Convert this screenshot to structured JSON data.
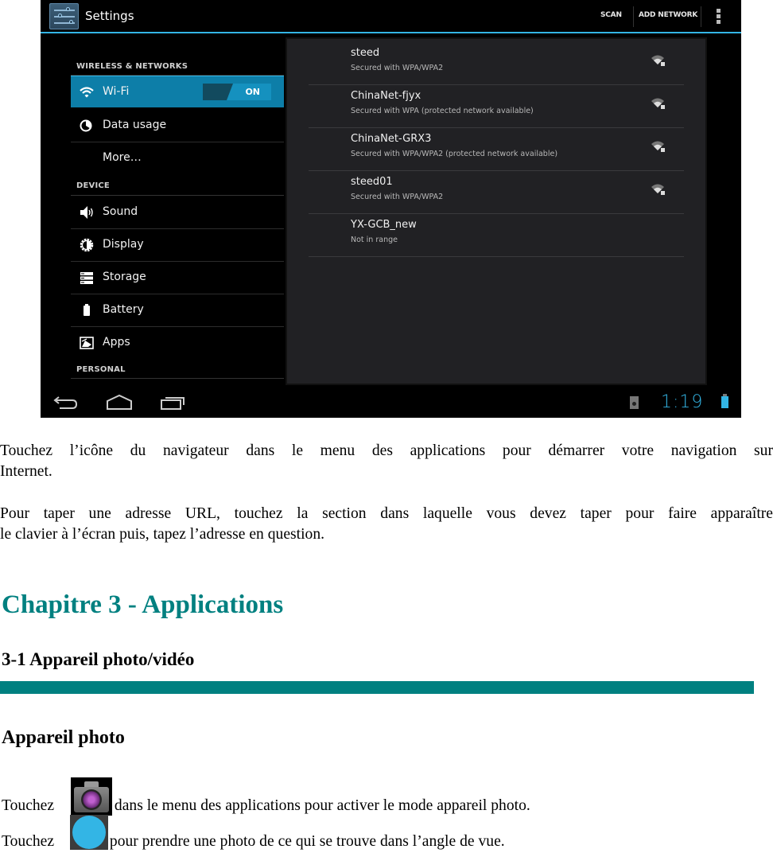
{
  "screenshot": {
    "action_bar": {
      "title": "Settings",
      "actions": [
        "SCAN",
        "ADD NETWORK"
      ],
      "overflow_icon": "overflow-menu-icon",
      "accent_color": "#33b5e5"
    },
    "sidebar": {
      "categories": {
        "wireless": "WIRELESS & NETWORKS",
        "device": "DEVICE",
        "personal": "PERSONAL"
      },
      "items": [
        {
          "label": "Wi-Fi",
          "icon": "wifi-icon",
          "selected": true,
          "toggle": "ON"
        },
        {
          "label": "Data usage",
          "icon": "data-usage-icon"
        },
        {
          "label": "More…",
          "icon": null
        },
        {
          "label": "Sound",
          "icon": "sound-icon"
        },
        {
          "label": "Display",
          "icon": "display-icon"
        },
        {
          "label": "Storage",
          "icon": "storage-icon"
        },
        {
          "label": "Battery",
          "icon": "battery-icon"
        },
        {
          "label": "Apps",
          "icon": "apps-icon"
        }
      ],
      "selected_color": "#0d7ea8"
    },
    "networks": [
      {
        "name": "steed",
        "status": "Secured with WPA/WPA2",
        "signal_icon": "wifi-lock-icon"
      },
      {
        "name": "ChinaNet-fjyx",
        "status": "Secured with WPA (protected network available)",
        "signal_icon": "wifi-lock-icon"
      },
      {
        "name": "ChinaNet-GRX3",
        "status": "Secured with WPA/WPA2 (protected network available)",
        "signal_icon": "wifi-lock-icon"
      },
      {
        "name": "steed01",
        "status": "Secured with WPA/WPA2",
        "signal_icon": "wifi-lock-icon"
      },
      {
        "name": "YX-GCB_new",
        "status": "Not in range",
        "signal_icon": null
      }
    ],
    "nav_bar": {
      "buttons": [
        "back-icon",
        "home-icon",
        "recent-apps-icon"
      ],
      "clock": "1:19",
      "status_icons": [
        "sd-card-icon",
        "battery-icon"
      ]
    }
  },
  "document": {
    "p1_line1": "Touchez l’icône du navigateur dans le menu des applications pour démarrer votre navigation sur",
    "p1_line2": "Internet.",
    "p2_line1": "Pour taper une adresse URL, touchez la section dans laquelle vous devez taper pour faire apparaître",
    "p2_line2": "le clavier à l’écran puis, tapez l’adresse en question.",
    "chapter_title": "Chapitre 3 - Applications",
    "section_title": "3-1 Appareil photo/vidéo",
    "subsection_title": "Appareil photo",
    "camera_line": {
      "prefix": "Touchez",
      "suffix": "dans le menu des applications pour activer le mode appareil photo.",
      "icon": "camera-app-icon"
    },
    "shutter_line": {
      "prefix": "Touchez",
      "suffix": "pour prendre une photo de ce qui se trouve dans l’angle de vue.",
      "icon": "shutter-button-icon"
    },
    "heading_color": "#008080"
  }
}
